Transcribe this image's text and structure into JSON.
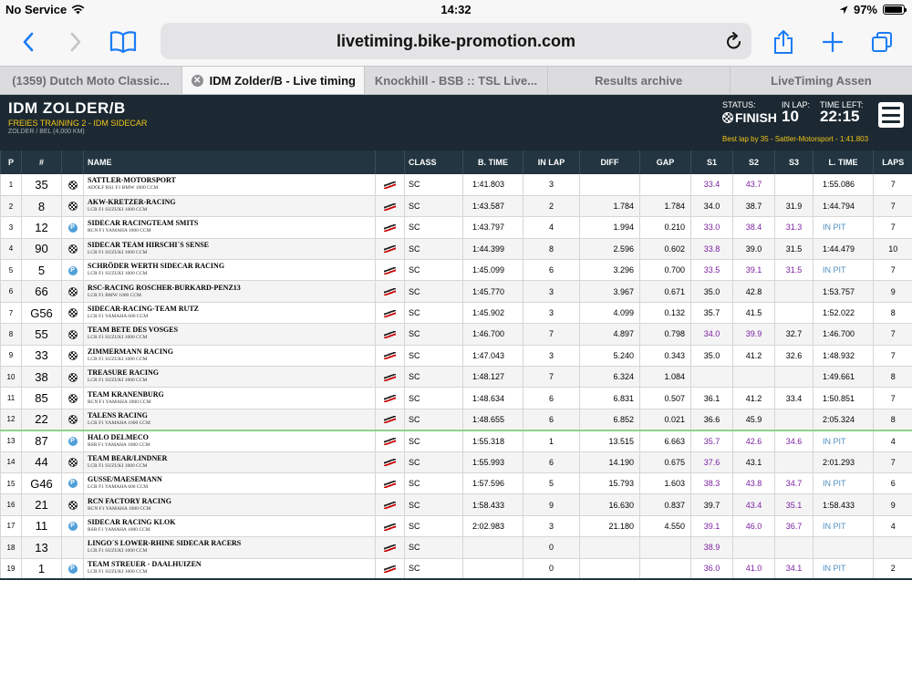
{
  "statusbar": {
    "carrier": "No Service",
    "time": "14:32",
    "battery": "97%",
    "battery_level": 0.97
  },
  "browser": {
    "url": "livetiming.bike-promotion.com"
  },
  "tabs": [
    {
      "label": "(1359) Dutch Moto Classic...",
      "active": false
    },
    {
      "label": "IDM Zolder/B - Live timing",
      "active": true
    },
    {
      "label": "Knockhill - BSB :: TSL Live...",
      "active": false
    },
    {
      "label": "Results archive",
      "active": false
    },
    {
      "label": "LiveTiming Assen",
      "active": false
    }
  ],
  "header": {
    "title": "IDM ZOLDER/B",
    "session": "FREIES TRAINING 2 - IDM SIDECAR",
    "location": "ZOLDER / BEL (4,000 KM)",
    "status_label": "STATUS:",
    "status_value": "FINISH",
    "inlap_label": "IN LAP:",
    "inlap_value": "10",
    "timeleft_label": "TIME LEFT:",
    "timeleft_value": "22:15",
    "best_lap": "Best lap by 35 - Sattler-Motorsport - 1:41.803"
  },
  "columns": [
    "P",
    "#",
    "",
    "NAME",
    "",
    "CLASS",
    "B. TIME",
    "IN LAP",
    "DIFF",
    "GAP",
    "S1",
    "S2",
    "S3",
    "L. TIME",
    "LAPS"
  ],
  "rows": [
    {
      "p": "1",
      "num": "35",
      "status": "flag",
      "team": "SATTLER-MOTORSPORT",
      "bike": "ADOLF RS1 F1 BMW 1000 CCM",
      "cls": "SC",
      "btime": "1:41.803",
      "inlap": "3",
      "diff": "",
      "gap": "",
      "s1": "33.4",
      "s1p": true,
      "s2": "43.7",
      "s2p": true,
      "s3": "",
      "s3p": false,
      "ltime": "1:55.086",
      "laps": "7"
    },
    {
      "p": "2",
      "num": "8",
      "status": "flag",
      "team": "AKW-KRETZER-RACING",
      "bike": "LCR F1 SUZUKI 1000 CCM",
      "cls": "SC",
      "btime": "1:43.587",
      "inlap": "2",
      "diff": "1.784",
      "gap": "1.784",
      "s1": "34.0",
      "s1p": false,
      "s2": "38.7",
      "s2p": false,
      "s3": "31.9",
      "s3p": false,
      "ltime": "1:44.794",
      "laps": "7"
    },
    {
      "p": "3",
      "num": "12",
      "status": "pit",
      "team": "SIDECAR RACINGTEAM SMITS",
      "bike": "RCN F1 YAMAHA 1000 CCM",
      "cls": "SC",
      "btime": "1:43.797",
      "inlap": "4",
      "diff": "1.994",
      "gap": "0.210",
      "s1": "33.0",
      "s1p": true,
      "s2": "38.4",
      "s2p": true,
      "s3": "31.3",
      "s3p": true,
      "ltime": "IN PIT",
      "laps": "7"
    },
    {
      "p": "4",
      "num": "90",
      "status": "flag",
      "team": "SIDECAR TEAM HIRSCHI´S SENSE",
      "bike": "LCR F1 SUZUKI 1000 CCM",
      "cls": "SC",
      "btime": "1:44.399",
      "inlap": "8",
      "diff": "2.596",
      "gap": "0.602",
      "s1": "33.8",
      "s1p": true,
      "s2": "39.0",
      "s2p": false,
      "s3": "31.5",
      "s3p": false,
      "ltime": "1:44.479",
      "laps": "10"
    },
    {
      "p": "5",
      "num": "5",
      "status": "pit",
      "team": "SCHRÖDER WERTH SIDECAR RACING",
      "bike": "LCR F1 SUZUKI 1000 CCM",
      "cls": "SC",
      "btime": "1:45.099",
      "inlap": "6",
      "diff": "3.296",
      "gap": "0.700",
      "s1": "33.5",
      "s1p": true,
      "s2": "39.1",
      "s2p": true,
      "s3": "31.5",
      "s3p": true,
      "ltime": "IN PIT",
      "laps": "7"
    },
    {
      "p": "6",
      "num": "66",
      "status": "flag",
      "team": "RSC-RACING ROSCHER-BURKARD-PENZ13",
      "bike": "LCR F1 BMW 1000 CCM",
      "cls": "SC",
      "btime": "1:45.770",
      "inlap": "3",
      "diff": "3.967",
      "gap": "0.671",
      "s1": "35.0",
      "s1p": false,
      "s2": "42.8",
      "s2p": false,
      "s3": "",
      "s3p": false,
      "ltime": "1:53.757",
      "laps": "9"
    },
    {
      "p": "7",
      "num": "G56",
      "status": "flag",
      "team": "SIDECAR-RACING-TEAM RUTZ",
      "bike": "LCR F1 YAMAHA 600 CCM",
      "cls": "SC",
      "btime": "1:45.902",
      "inlap": "3",
      "diff": "4.099",
      "gap": "0.132",
      "s1": "35.7",
      "s1p": false,
      "s2": "41.5",
      "s2p": false,
      "s3": "",
      "s3p": false,
      "ltime": "1:52.022",
      "laps": "8"
    },
    {
      "p": "8",
      "num": "55",
      "status": "flag",
      "team": "TEAM BETE DES VOSGES",
      "bike": "LCR F1 SUZUKI 1000 CCM",
      "cls": "SC",
      "btime": "1:46.700",
      "inlap": "7",
      "diff": "4.897",
      "gap": "0.798",
      "s1": "34.0",
      "s1p": true,
      "s2": "39.9",
      "s2p": true,
      "s3": "32.7",
      "s3p": false,
      "ltime": "1:46.700",
      "laps": "7"
    },
    {
      "p": "9",
      "num": "33",
      "status": "flag",
      "team": "ZIMMERMANN RACING",
      "bike": "LCR F1 SUZUKI 1000 CCM",
      "cls": "SC",
      "btime": "1:47.043",
      "inlap": "3",
      "diff": "5.240",
      "gap": "0.343",
      "s1": "35.0",
      "s1p": false,
      "s2": "41.2",
      "s2p": false,
      "s3": "32.6",
      "s3p": false,
      "ltime": "1:48.932",
      "laps": "7"
    },
    {
      "p": "10",
      "num": "38",
      "status": "flag",
      "team": "TREASURE RACING",
      "bike": "LCR F1 SUZUKI 1000 CCM",
      "cls": "SC",
      "btime": "1:48.127",
      "inlap": "7",
      "diff": "6.324",
      "gap": "1.084",
      "s1": "",
      "s1p": false,
      "s2": "",
      "s2p": false,
      "s3": "",
      "s3p": false,
      "ltime": "1:49.661",
      "laps": "8"
    },
    {
      "p": "11",
      "num": "85",
      "status": "flag",
      "team": "TEAM KRANENBURG",
      "bike": "RCN F1 YAMAHA 1000 CCM",
      "cls": "SC",
      "btime": "1:48.634",
      "inlap": "6",
      "diff": "6.831",
      "gap": "0.507",
      "s1": "36.1",
      "s1p": false,
      "s2": "41.2",
      "s2p": false,
      "s3": "33.4",
      "s3p": false,
      "ltime": "1:50.851",
      "laps": "7"
    },
    {
      "p": "12",
      "num": "22",
      "status": "flag",
      "team": "TALENS RACING",
      "bike": "LCR F1 YAMAHA 1000 CCM",
      "cls": "SC",
      "btime": "1:48.655",
      "inlap": "6",
      "diff": "6.852",
      "gap": "0.021",
      "s1": "36.6",
      "s1p": false,
      "s2": "45.9",
      "s2p": false,
      "s3": "",
      "s3p": false,
      "ltime": "2:05.324",
      "laps": "8"
    },
    {
      "p": "13",
      "num": "87",
      "status": "pit",
      "team": "HALO DELMECO",
      "bike": "RSR F1 YAMAHA 1000 CCM",
      "cls": "SC",
      "btime": "1:55.318",
      "inlap": "1",
      "diff": "13.515",
      "gap": "6.663",
      "s1": "35.7",
      "s1p": true,
      "s2": "42.6",
      "s2p": true,
      "s3": "34.6",
      "s3p": true,
      "ltime": "IN PIT",
      "laps": "4"
    },
    {
      "p": "14",
      "num": "44",
      "status": "flag",
      "team": "TEAM BEAR/LINDNER",
      "bike": "LCR F1 SUZUKI 1000 CCM",
      "cls": "SC",
      "btime": "1:55.993",
      "inlap": "6",
      "diff": "14.190",
      "gap": "0.675",
      "s1": "37.6",
      "s1p": true,
      "s2": "43.1",
      "s2p": false,
      "s3": "",
      "s3p": false,
      "ltime": "2:01.293",
      "laps": "7"
    },
    {
      "p": "15",
      "num": "G46",
      "status": "pit",
      "team": "GUSSE/MAESEMANN",
      "bike": "LCR F1 YAMAHA 600 CCM",
      "cls": "SC",
      "btime": "1:57.596",
      "inlap": "5",
      "diff": "15.793",
      "gap": "1.603",
      "s1": "38.3",
      "s1p": true,
      "s2": "43.8",
      "s2p": true,
      "s3": "34.7",
      "s3p": true,
      "ltime": "IN PIT",
      "laps": "6"
    },
    {
      "p": "16",
      "num": "21",
      "status": "flag",
      "team": "RCN FACTORY RACING",
      "bike": "RCN F1 YAMAHA 1000 CCM",
      "cls": "SC",
      "btime": "1:58.433",
      "inlap": "9",
      "diff": "16.630",
      "gap": "0.837",
      "s1": "39.7",
      "s1p": false,
      "s2": "43.4",
      "s2p": true,
      "s3": "35.1",
      "s3p": true,
      "ltime": "1:58.433",
      "laps": "9"
    },
    {
      "p": "17",
      "num": "11",
      "status": "pit",
      "team": "SIDECAR RACING KLOK",
      "bike": "RSR F1 YAMAHA 1000 CCM",
      "cls": "SC",
      "btime": "2:02.983",
      "inlap": "3",
      "diff": "21.180",
      "gap": "4.550",
      "s1": "39.1",
      "s1p": true,
      "s2": "46.0",
      "s2p": true,
      "s3": "36.7",
      "s3p": true,
      "ltime": "IN PIT",
      "laps": "4"
    },
    {
      "p": "18",
      "num": "13",
      "status": "none",
      "team": "LINGO´S LOWER-RHINE SIDECAR RACERS",
      "bike": "LCR F1 SUZUKI 1000 CCM",
      "cls": "SC",
      "btime": "",
      "inlap": "0",
      "diff": "",
      "gap": "",
      "s1": "38.9",
      "s1p": true,
      "s2": "",
      "s2p": false,
      "s3": "",
      "s3p": false,
      "ltime": "",
      "laps": ""
    },
    {
      "p": "19",
      "num": "1",
      "status": "pit",
      "team": "TEAM STREUER - DAALHUIZEN",
      "bike": "LCR F1 SUZUKI 1000 CCM",
      "cls": "SC",
      "btime": "",
      "inlap": "0",
      "diff": "",
      "gap": "",
      "s1": "36.0",
      "s1p": true,
      "s2": "41.0",
      "s2p": true,
      "s3": "34.1",
      "s3p": true,
      "ltime": "IN PIT",
      "laps": "2"
    }
  ]
}
